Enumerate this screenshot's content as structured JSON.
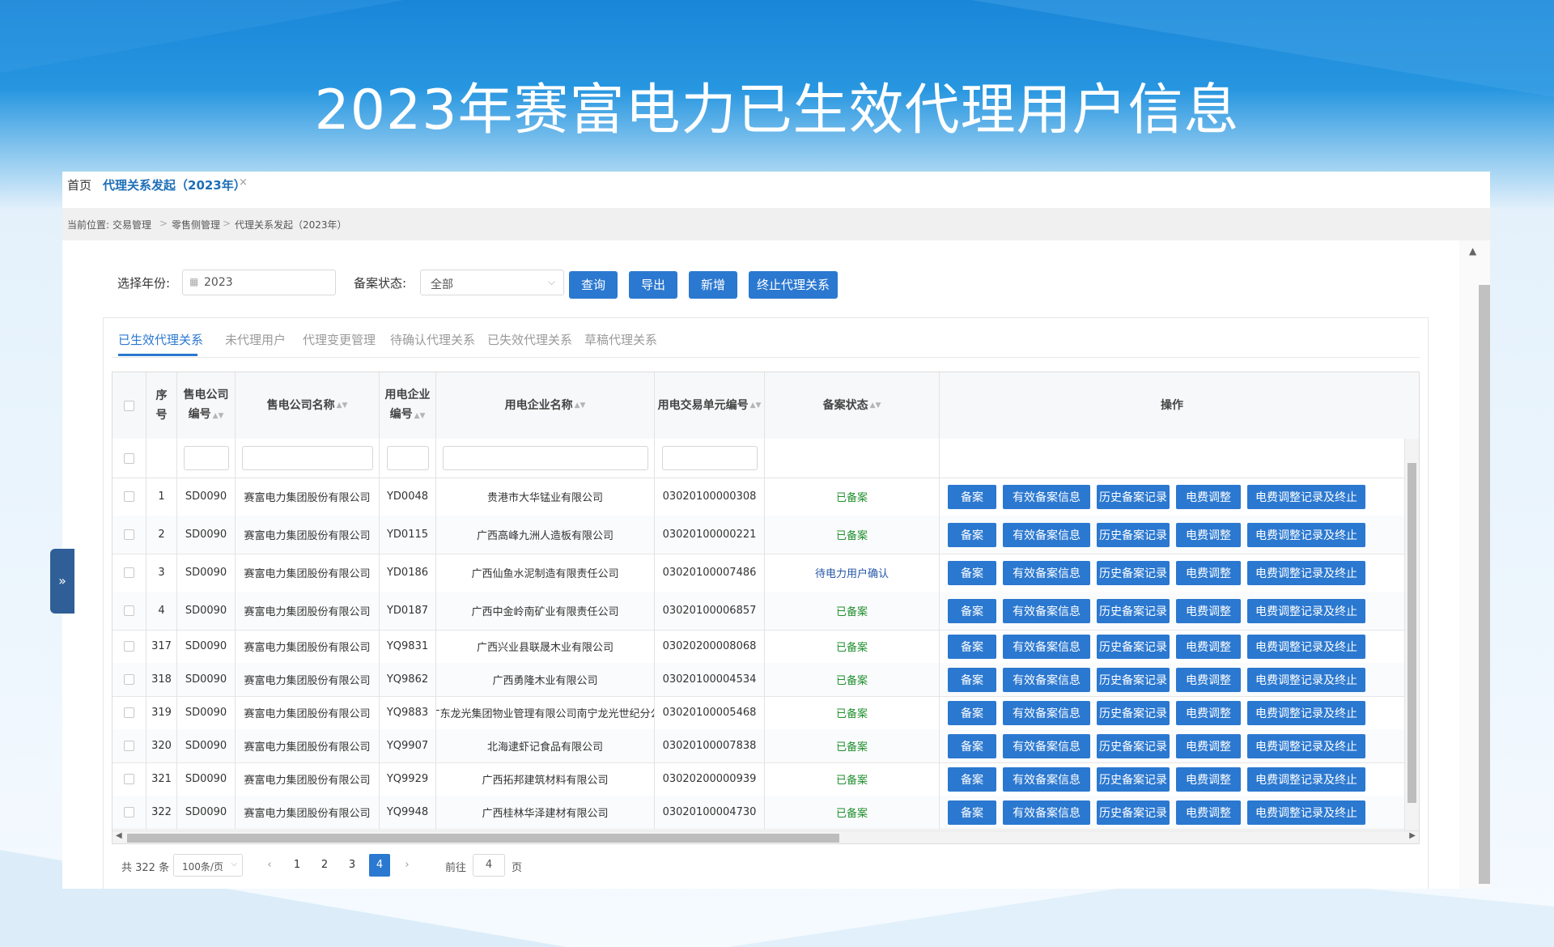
{
  "slide": {
    "title": "2023年赛富电力已生效代理用户信息"
  },
  "tabs": {
    "home": "首页",
    "active": "代理关系发起（2023年）",
    "close": "×"
  },
  "breadcrumb": {
    "prefix": "当前位置:",
    "items": [
      "交易管理",
      "零售侧管理",
      "代理关系发起（2023年）"
    ],
    "separator": ">"
  },
  "filters": {
    "year_label": "选择年份:",
    "year_value": "2023",
    "status_label": "备案状态:",
    "status_value": "全部",
    "buttons": {
      "query": "查询",
      "export": "导出",
      "add": "新增",
      "terminate": "终止代理关系"
    }
  },
  "subtabs": [
    "已生效代理关系",
    "未代理用户",
    "代理变更管理",
    "待确认代理关系",
    "已失效代理关系",
    "草稿代理关系"
  ],
  "table": {
    "headers": {
      "seq": [
        "序",
        "号"
      ],
      "seller_code": [
        "售电公司",
        "编号"
      ],
      "seller_name": "售电公司名称",
      "user_code": [
        "用电企业",
        "编号"
      ],
      "user_name": "用电企业名称",
      "unit_code": "用电交易单元编号",
      "status": "备案状态",
      "actions": "操作"
    },
    "action_labels": [
      "备案",
      "有效备案信息",
      "历史备案记录",
      "电费调整",
      "电费调整记录及终止"
    ],
    "rows": [
      {
        "seq": "1",
        "seller_code": "SD0090",
        "seller_name": "赛富电力集团股份有限公司",
        "user_code": "YD0048",
        "user_name": "贵港市大华锰业有限公司",
        "unit_code": "03020100000308",
        "status": "已备案",
        "status_type": "ok"
      },
      {
        "seq": "2",
        "seller_code": "SD0090",
        "seller_name": "赛富电力集团股份有限公司",
        "user_code": "YD0115",
        "user_name": "广西高峰九洲人造板有限公司",
        "unit_code": "03020100000221",
        "status": "已备案",
        "status_type": "ok"
      },
      {
        "seq": "3",
        "seller_code": "SD0090",
        "seller_name": "赛富电力集团股份有限公司",
        "user_code": "YD0186",
        "user_name": "广西仙鱼水泥制造有限责任公司",
        "unit_code": "03020100007486",
        "status": "待电力用户确认",
        "status_type": "wait"
      },
      {
        "seq": "4",
        "seller_code": "SD0090",
        "seller_name": "赛富电力集团股份有限公司",
        "user_code": "YD0187",
        "user_name": "广西中金岭南矿业有限责任公司",
        "unit_code": "03020100006857",
        "status": "已备案",
        "status_type": "ok"
      },
      {
        "seq": "317",
        "seller_code": "SD0090",
        "seller_name": "赛富电力集团股份有限公司",
        "user_code": "YQ9831",
        "user_name": "广西兴业县联晟木业有限公司",
        "unit_code": "03020200008068",
        "status": "已备案",
        "status_type": "ok"
      },
      {
        "seq": "318",
        "seller_code": "SD0090",
        "seller_name": "赛富电力集团股份有限公司",
        "user_code": "YQ9862",
        "user_name": "广西勇隆木业有限公司",
        "unit_code": "03020100004534",
        "status": "已备案",
        "status_type": "ok"
      },
      {
        "seq": "319",
        "seller_code": "SD0090",
        "seller_name": "赛富电力集团股份有限公司",
        "user_code": "YQ9883",
        "user_name": "广东龙光集团物业管理有限公司南宁龙光世纪分公",
        "unit_code": "03020100005468",
        "status": "已备案",
        "status_type": "ok"
      },
      {
        "seq": "320",
        "seller_code": "SD0090",
        "seller_name": "赛富电力集团股份有限公司",
        "user_code": "YQ9907",
        "user_name": "北海逮虾记食品有限公司",
        "unit_code": "03020100007838",
        "status": "已备案",
        "status_type": "ok"
      },
      {
        "seq": "321",
        "seller_code": "SD0090",
        "seller_name": "赛富电力集团股份有限公司",
        "user_code": "YQ9929",
        "user_name": "广西拓邦建筑材料有限公司",
        "unit_code": "03020200000939",
        "status": "已备案",
        "status_type": "ok"
      },
      {
        "seq": "322",
        "seller_code": "SD0090",
        "seller_name": "赛富电力集团股份有限公司",
        "user_code": "YQ9948",
        "user_name": "广西桂林华泽建材有限公司",
        "unit_code": "03020100004730",
        "status": "已备案",
        "status_type": "ok"
      }
    ]
  },
  "pagination": {
    "total": "共 322 条",
    "page_size": "100条/页",
    "prev": "‹",
    "next": "›",
    "pages": [
      "1",
      "2",
      "3",
      "4"
    ],
    "current": "4",
    "goto_label": "前往",
    "goto_value": "4",
    "page_unit": "页"
  },
  "sidebar_handle": {
    "icon": "»"
  },
  "colors": {
    "primary": "#2b78d0",
    "status_ok": "#1f8f2e",
    "status_wait": "#2456a8",
    "banner": "#1a86d8"
  }
}
